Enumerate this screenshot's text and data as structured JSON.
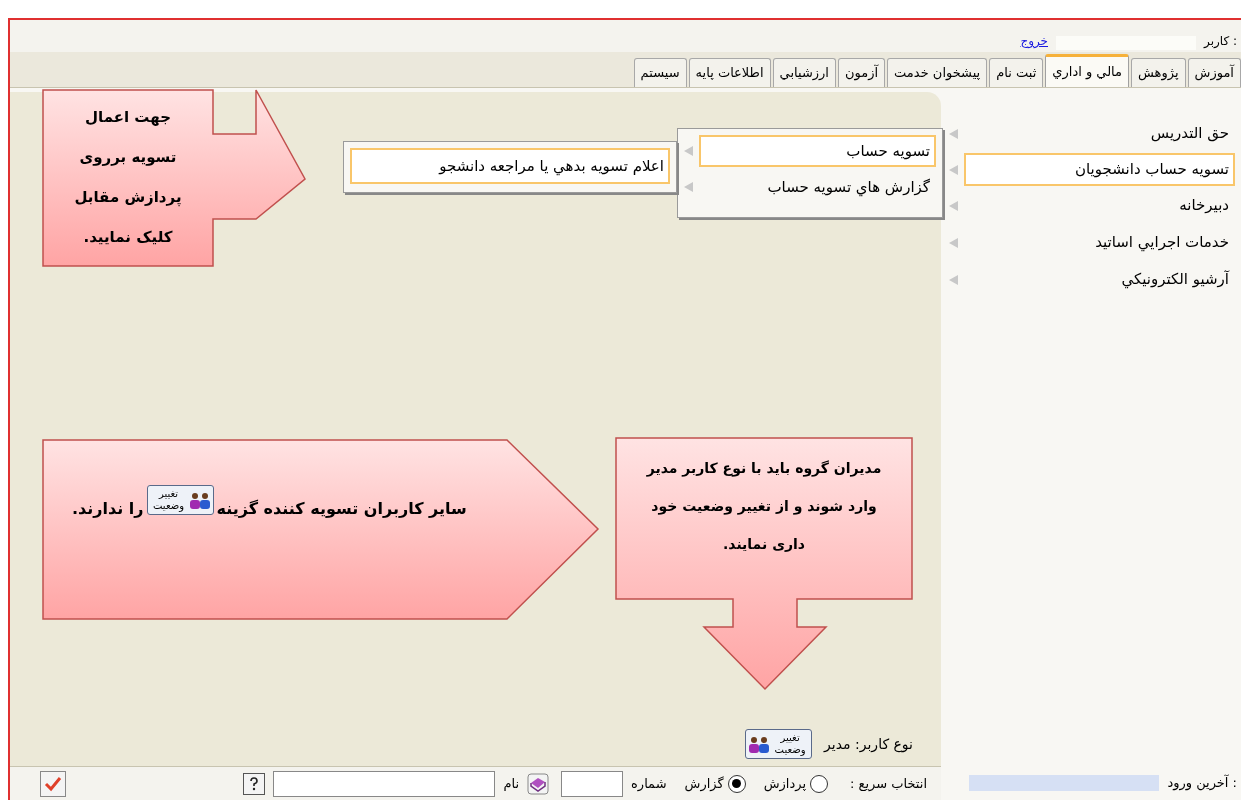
{
  "header": {
    "user_label": "كاربر :",
    "logout_link": "خروج"
  },
  "tabs": [
    {
      "label": "آموزش",
      "selected": false
    },
    {
      "label": "پژوهش",
      "selected": false
    },
    {
      "label": "مالي و اداري",
      "selected": true
    },
    {
      "label": "ثبت نام",
      "selected": false
    },
    {
      "label": "پيشخوان خدمت",
      "selected": false
    },
    {
      "label": "آزمون",
      "selected": false
    },
    {
      "label": "ارزشيابي",
      "selected": false
    },
    {
      "label": "اطلاعات پايه",
      "selected": false
    },
    {
      "label": "سيستم",
      "selected": false
    }
  ],
  "sidebar": {
    "items": [
      {
        "label": "حق التدريس",
        "selected": false
      },
      {
        "label": "تسويه حساب دانشجويان",
        "selected": true
      },
      {
        "label": "دبيرخانه",
        "selected": false
      },
      {
        "label": "خدمات اجرايي اساتيد",
        "selected": false
      },
      {
        "label": "آرشيو الكترونيكي",
        "selected": false
      }
    ],
    "last_login_label": "آخرين ورود :"
  },
  "submenu": {
    "items": [
      {
        "label": "تسويه حساب",
        "selected": true
      },
      {
        "label": "گزارش هاي تسويه حساب",
        "selected": false
      }
    ]
  },
  "submenu_2": {
    "items": [
      {
        "label": "اعلام تسويه بدهي يا مراجعه دانشجو",
        "selected": true
      }
    ]
  },
  "callouts": [
    {
      "kind": "right-arrow",
      "text": "جهت اعمال تسويه برروی پردازش مقابل کليک نماييد."
    },
    {
      "kind": "down-arrow",
      "text": "مديران گروه بايد با نوع كاربر مدير وارد شوند و از تغيير وضعيت خود داری نمايند."
    },
    {
      "kind": "pentagon",
      "text_before": "ساير كاربران تسويه كننده گزينه",
      "icon_label": "تغيير وضعيت",
      "text_after": "را ندارند."
    }
  ],
  "user_type": {
    "label": "نوع كاربر: مدير",
    "change_button": "تغيير وضعيت"
  },
  "quick_select": {
    "label": "انتخاب سريع :",
    "options": [
      {
        "label": "پردازش",
        "selected": false
      },
      {
        "label": "گزارش",
        "selected": true
      }
    ],
    "number_label": "شماره",
    "name_label": "نام"
  }
}
